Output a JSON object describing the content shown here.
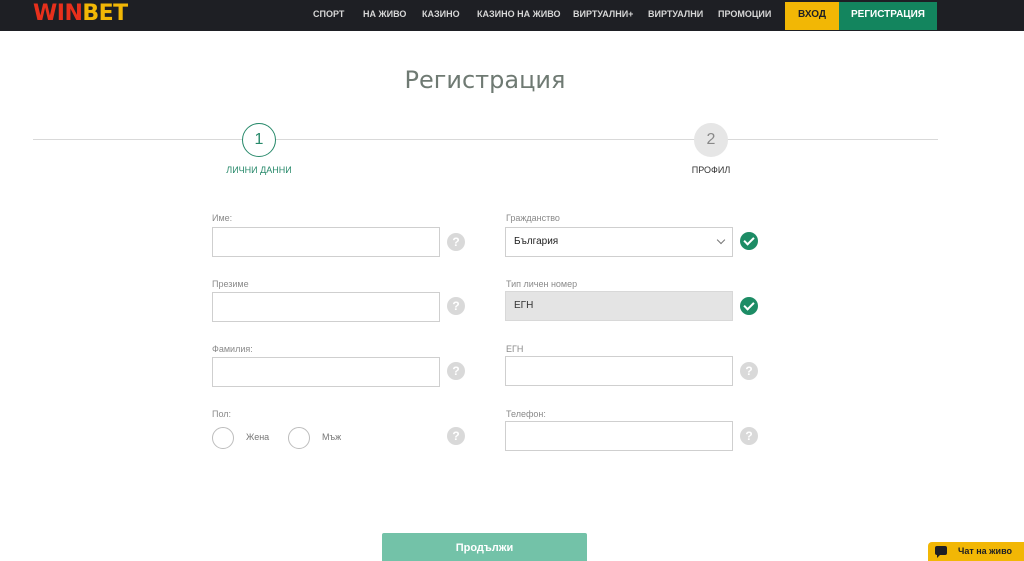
{
  "header": {
    "logo_win": "WIN",
    "logo_bet": "BET",
    "nav": [
      "СПОРТ",
      "НА ЖИВО",
      "КАЗИНО",
      "КАЗИНО НА ЖИВО",
      "ВИРТУАЛНИ+",
      "ВИРТУАЛНИ",
      "ПРОМОЦИИ"
    ],
    "login": "ВХОД",
    "register": "РЕГИСТРАЦИЯ"
  },
  "page": {
    "title": "Регистрация"
  },
  "stepper": {
    "steps": [
      {
        "number": "1",
        "label": "ЛИЧНИ ДАННИ",
        "active": true
      },
      {
        "number": "2",
        "label": "ПРОФИЛ",
        "active": false
      }
    ]
  },
  "form": {
    "first_name": {
      "label": "Име:",
      "value": ""
    },
    "middle_name": {
      "label": "Презиме",
      "value": ""
    },
    "last_name": {
      "label": "Фамилия:",
      "value": ""
    },
    "gender": {
      "label": "Пол:",
      "options": [
        "Жена",
        "Мъж"
      ]
    },
    "citizenship": {
      "label": "Гражданство",
      "value": "България"
    },
    "id_type": {
      "label": "Тип личен номер",
      "value": "ЕГН"
    },
    "egn": {
      "label": "ЕГН",
      "value": ""
    },
    "phone": {
      "label": "Телефон:",
      "value": ""
    },
    "help_symbol": "?"
  },
  "actions": {
    "continue": "Продължи"
  },
  "chat": {
    "label": "Чат на живо"
  },
  "colors": {
    "accent_green": "#13855e",
    "accent_yellow": "#f2b705",
    "header_bg": "#1e1f24"
  }
}
